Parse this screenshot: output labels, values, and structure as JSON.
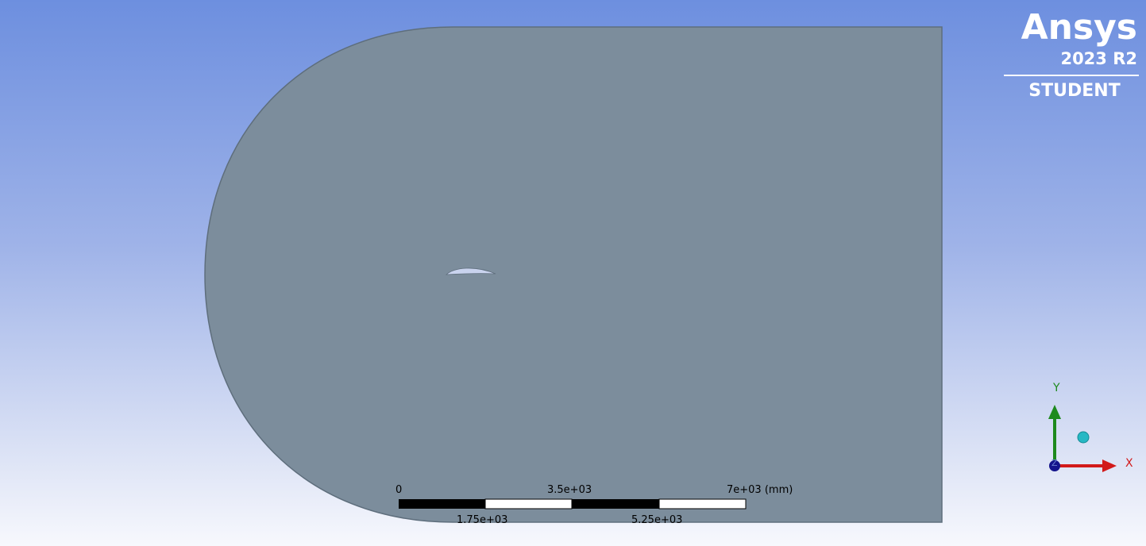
{
  "logo": {
    "brand": "Ansys",
    "version": "2023 R2",
    "edition": "STUDENT"
  },
  "scale_bar": {
    "top_labels": [
      "0",
      "3.5e+03",
      "7e+03 (mm)"
    ],
    "bottom_labels": [
      "1.75e+03",
      "5.25e+03"
    ]
  },
  "triad": {
    "y_label": "Y",
    "x_label": "X",
    "z_label": "Z",
    "colors": {
      "x": "#d21a1a",
      "y": "#1d8a1d",
      "z": "#14148c",
      "sphere": "#26b8c4"
    }
  },
  "colors": {
    "domain_fill": "#7c8d9c",
    "domain_edge": "#5e6e7c",
    "airfoil_fill": "#c9d3ee"
  }
}
